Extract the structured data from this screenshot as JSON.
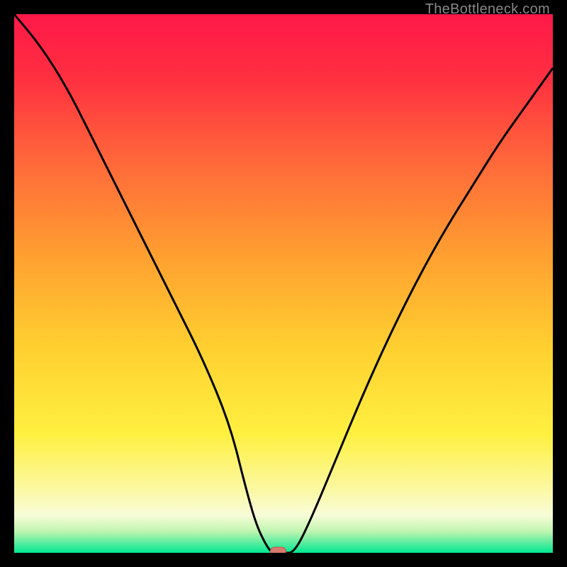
{
  "watermark": "TheBottleneck.com",
  "colors": {
    "black": "#000000",
    "gradient_top": "#ff1744",
    "gradient_upper": "#ff5533",
    "gradient_mid": "#ffb300",
    "gradient_lower": "#ffeb3b",
    "gradient_pale": "#fff59d",
    "gradient_bottom": "#00e676",
    "curve": "#000000",
    "marker_fill": "#d87a6e",
    "watermark": "#888888"
  },
  "chart_data": {
    "type": "line",
    "title": "",
    "xlabel": "",
    "ylabel": "",
    "xlim": [
      0,
      100
    ],
    "ylim": [
      0,
      100
    ],
    "series": [
      {
        "name": "bottleneck-curve",
        "x": [
          0,
          5,
          10,
          15,
          20,
          25,
          30,
          35,
          40,
          43,
          45,
          47,
          48,
          50,
          52,
          55,
          60,
          65,
          70,
          75,
          80,
          85,
          90,
          95,
          100
        ],
        "y": [
          100,
          94,
          86,
          76,
          66,
          56,
          46,
          36,
          24,
          12,
          5,
          1,
          0,
          0,
          0,
          6,
          18,
          30,
          41,
          51,
          60,
          68,
          76,
          83,
          90
        ]
      }
    ],
    "marker": {
      "x": 49,
      "y": 0
    },
    "annotations": []
  }
}
